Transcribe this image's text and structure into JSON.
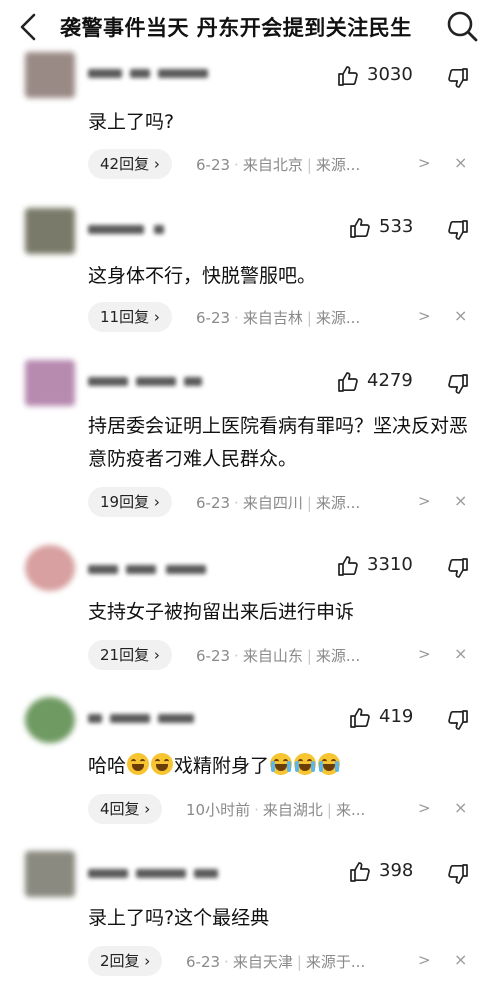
{
  "header": {
    "back_icon": "chevron-left-icon",
    "title": "袭警事件当天 丹东开会提到关注民生",
    "search_icon": "search-icon"
  },
  "comments": [
    {
      "likes": "3030",
      "text": "录上了吗?",
      "replies": "42回复 ›",
      "date": "6-23",
      "location": "来自北京",
      "source": "来源...",
      "more": ">",
      "close": "×",
      "avatar_color": "#9a8a86"
    },
    {
      "likes": "533",
      "text": "这身体不行，快脱警服吧。",
      "replies": "11回复 ›",
      "date": "6-23",
      "location": "来自吉林",
      "source": "来源...",
      "more": ">",
      "close": "×",
      "avatar_color": "#7a7a6a"
    },
    {
      "likes": "4279",
      "text": "持居委会证明上医院看病有罪吗？坚决反对恶意防疫者刁难人民群众。",
      "replies": "19回复 ›",
      "date": "6-23",
      "location": "来自四川",
      "source": "来源...",
      "more": ">",
      "close": "×",
      "avatar_color": "#b78ab0"
    },
    {
      "likes": "3310",
      "text": "支持女子被拘留出来后进行申诉",
      "replies": "21回复 ›",
      "date": "6-23",
      "location": "来自山东",
      "source": "来源...",
      "more": ">",
      "close": "×",
      "avatar_color": "#d8a0a0"
    },
    {
      "likes": "419",
      "text_prefix": "哈哈",
      "text_mid": "戏精附身了",
      "replies": "4回复 ›",
      "date": "10小时前",
      "location": "来自湖北",
      "source": "来...",
      "more": ">",
      "close": "×",
      "avatar_color": "#6f9a62"
    },
    {
      "likes": "398",
      "text": "录上了吗?这个最经典",
      "replies": "2回复 ›",
      "date": "6-23",
      "location": "来自天津",
      "source": "来源于...",
      "more": ">",
      "close": "×",
      "avatar_color": "#8a8a80"
    }
  ],
  "icons": {
    "like": "thumbs-up-icon",
    "dislike": "thumbs-down-icon",
    "laugh": "grinning-face-emoji",
    "cry": "loudly-crying-face-emoji"
  }
}
